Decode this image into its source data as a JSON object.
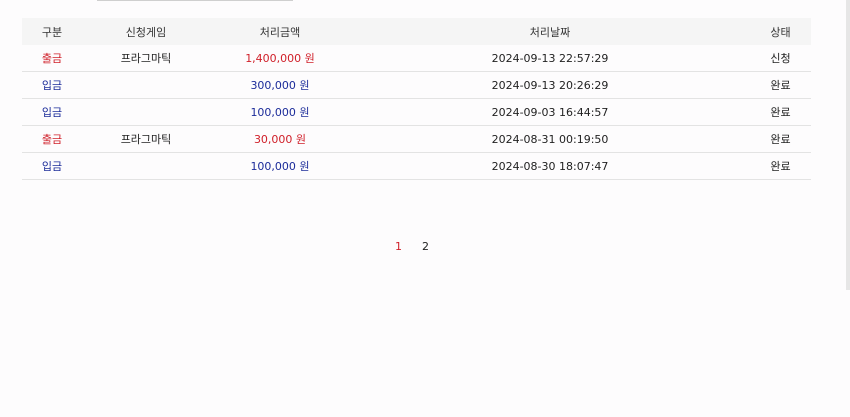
{
  "table": {
    "headers": {
      "type": "구분",
      "game": "신청게임",
      "amount": "처리금액",
      "date": "처리날짜",
      "status": "상태"
    },
    "rows": [
      {
        "type": "출금",
        "game": "프라그마틱",
        "amount": "1,400,000 원",
        "date": "2024-09-13 22:57:29",
        "status": "신청"
      },
      {
        "type": "입금",
        "game": "",
        "amount": "300,000 원",
        "date": "2024-09-13 20:26:29",
        "status": "완료"
      },
      {
        "type": "입금",
        "game": "",
        "amount": "100,000 원",
        "date": "2024-09-03 16:44:57",
        "status": "완료"
      },
      {
        "type": "출금",
        "game": "프라그마틱",
        "amount": "30,000 원",
        "date": "2024-08-31 00:19:50",
        "status": "완료"
      },
      {
        "type": "입금",
        "game": "",
        "amount": "100,000 원",
        "date": "2024-08-30 18:07:47",
        "status": "완료"
      }
    ]
  },
  "pagination": {
    "pages": [
      "1",
      "2"
    ],
    "current": "1"
  },
  "colors": {
    "withdraw": "#d0202a",
    "deposit": "#1c2c9a",
    "current_page": "#d0202a"
  }
}
